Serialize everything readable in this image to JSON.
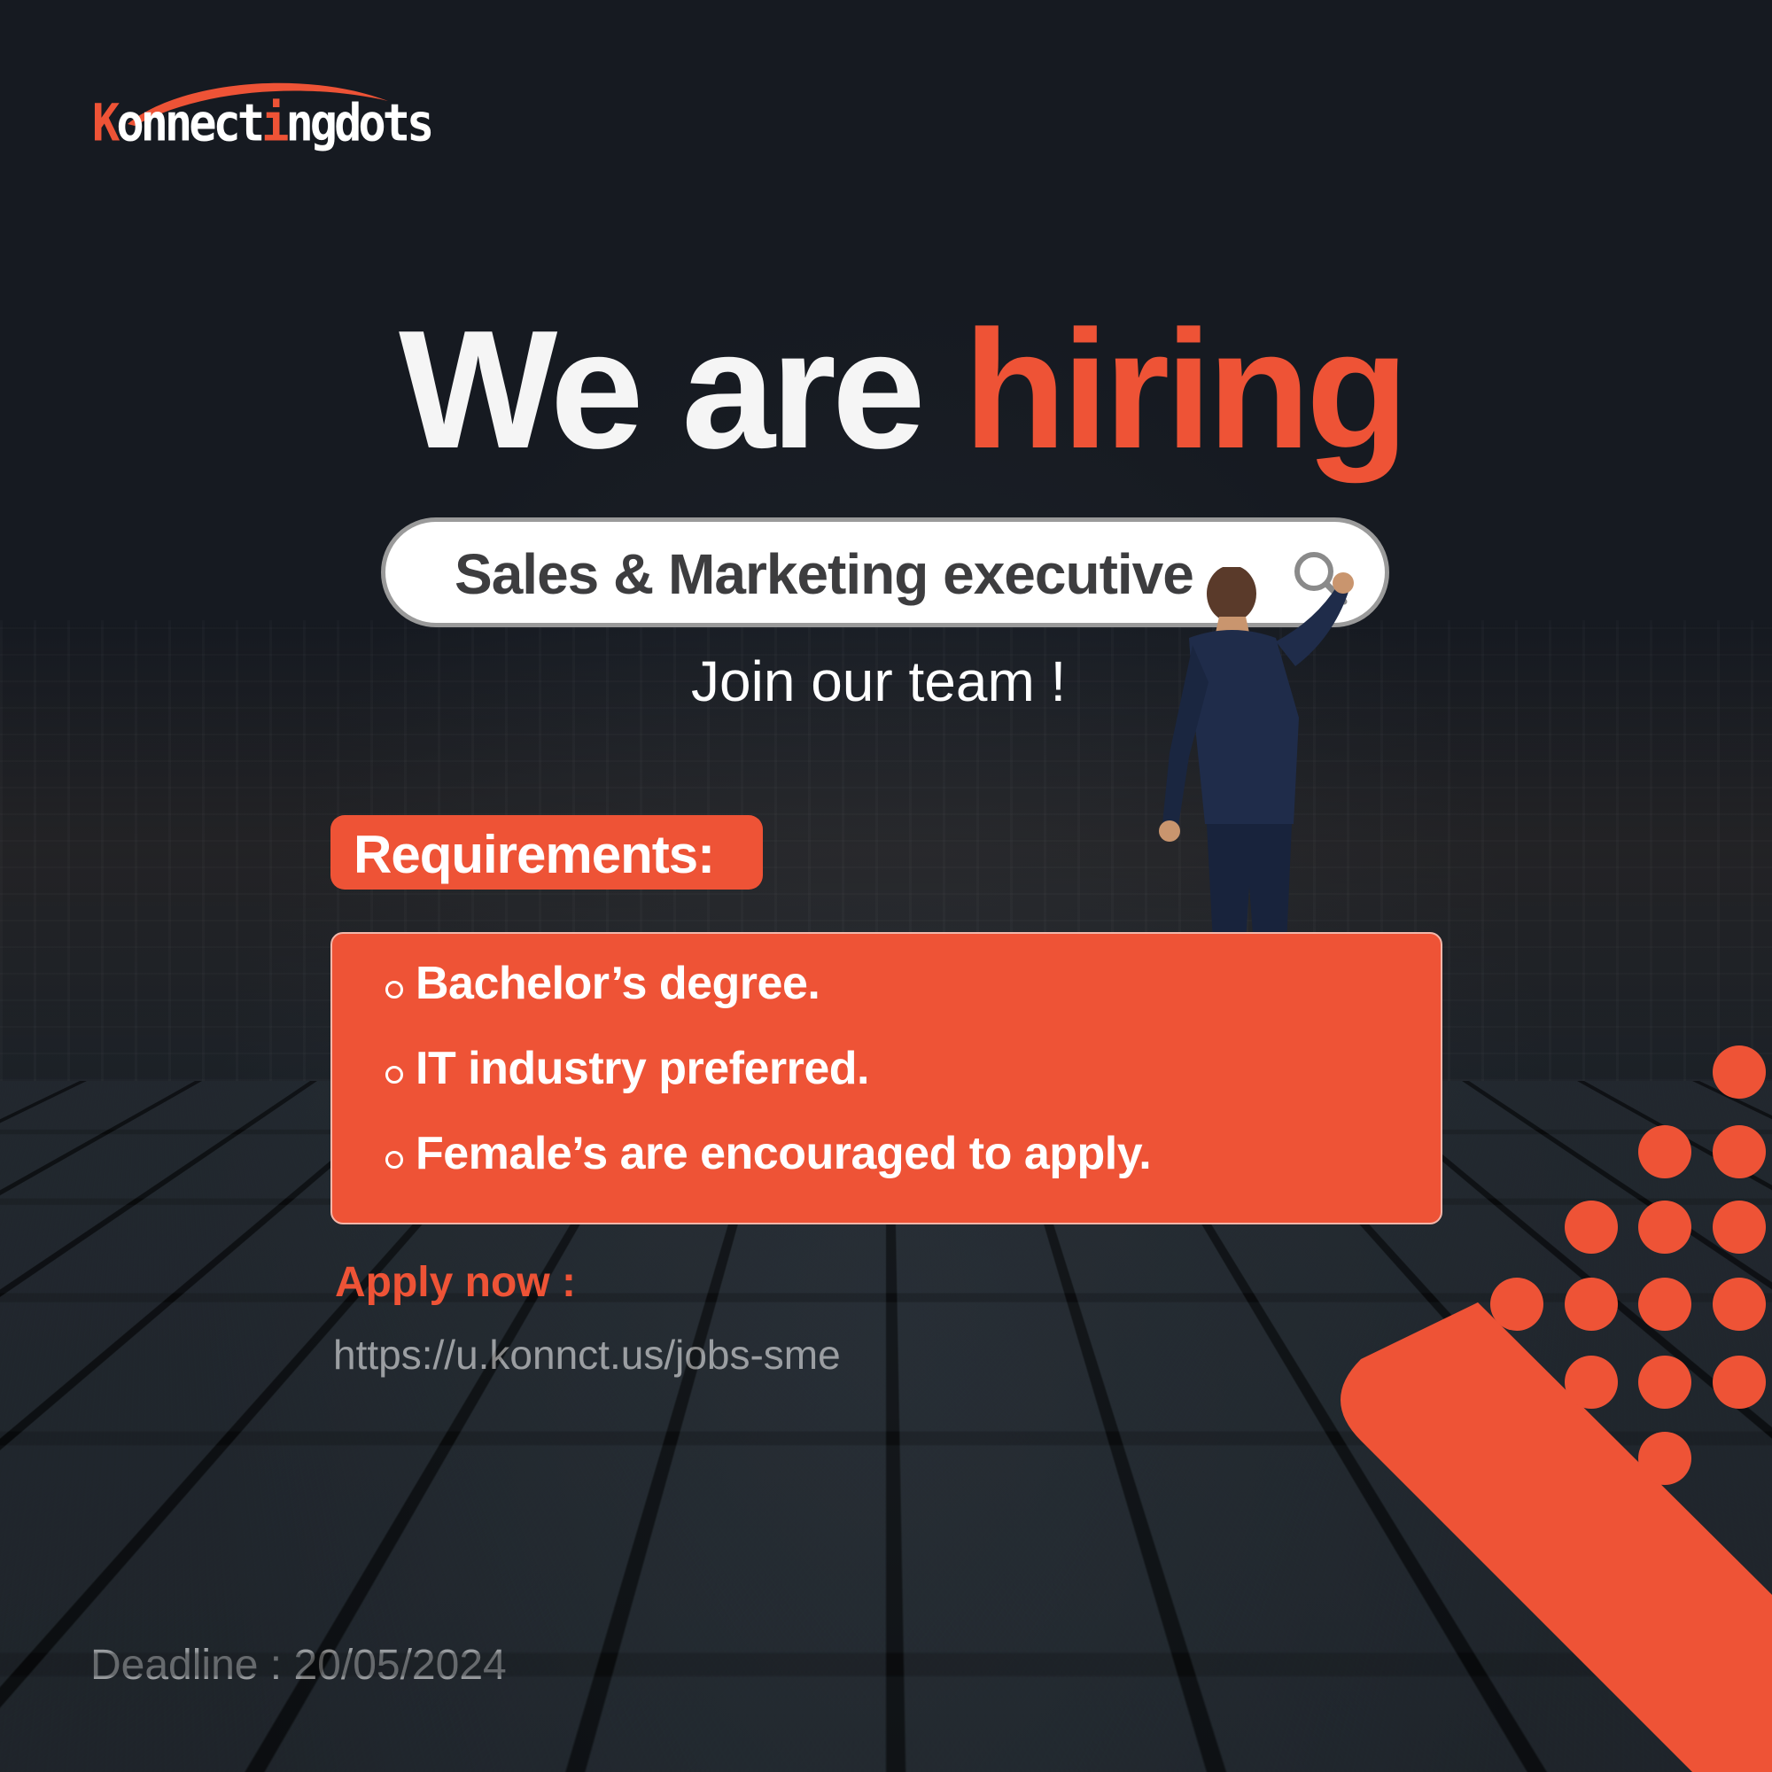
{
  "brand": {
    "logo_k": "K",
    "logo_part1": "onnect",
    "logo_i": "i",
    "logo_part2": "ngdots",
    "accent_color": "#ee5336"
  },
  "headline": {
    "white": "We are",
    "orange": "hiring"
  },
  "search": {
    "value": "Sales & Marketing executive",
    "icon": "search-icon"
  },
  "tagline": "Join our team !",
  "requirements": {
    "label": "Requirements:",
    "items": [
      "Bachelor’s degree.",
      "IT industry preferred.",
      "Female’s are encouraged to apply."
    ]
  },
  "apply": {
    "label": "Apply now :",
    "url": "https://u.konnct.us/jobs-sme"
  },
  "deadline": "Deadline : 20/05/2024"
}
